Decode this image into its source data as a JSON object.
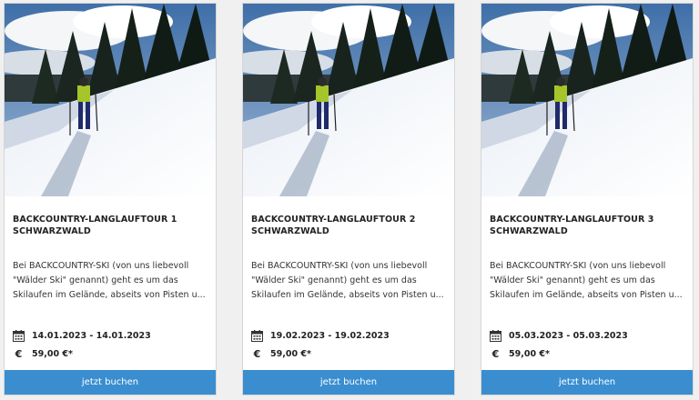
{
  "tours": [
    {
      "title_line1": "BACKCOUNTRY-LANGLAUFTOUR 1",
      "title_line2": "SCHWARZWALD",
      "desc_line1": "Bei BACKCOUNTRY-SKI (von uns liebevoll",
      "desc_line2": "\"Wälder Ski\" genannt) geht es um das",
      "desc_line3": "Skilaufen im Gelände, abseits von Pisten u...",
      "date_range": "14.01.2023 - 14.01.2023",
      "price": "59,00 €*",
      "book_label": "jetzt buchen"
    },
    {
      "title_line1": "BACKCOUNTRY-LANGLAUFTOUR 2",
      "title_line2": "SCHWARZWALD",
      "desc_line1": "Bei BACKCOUNTRY-SKI (von uns liebevoll",
      "desc_line2": "\"Wälder Ski\" genannt) geht es um das",
      "desc_line3": "Skilaufen im Gelände, abseits von Pisten u...",
      "date_range": "19.02.2023 - 19.02.2023",
      "price": "59,00 €*",
      "book_label": "jetzt buchen"
    },
    {
      "title_line1": "BACKCOUNTRY-LANGLAUFTOUR 3",
      "title_line2": "SCHWARZWALD",
      "desc_line1": "Bei BACKCOUNTRY-SKI (von uns liebevoll",
      "desc_line2": "\"Wälder Ski\" genannt) geht es um das",
      "desc_line3": "Skilaufen im Gelände, abseits von Pisten u...",
      "date_range": "05.03.2023 - 05.03.2023",
      "price": "59,00 €*",
      "book_label": "jetzt buchen"
    }
  ],
  "icons": {
    "date": "calendar-icon",
    "price": "euro-icon"
  },
  "currency_symbol": "€",
  "colors": {
    "button": "#3a8ed0",
    "button_text": "#ffffff"
  }
}
